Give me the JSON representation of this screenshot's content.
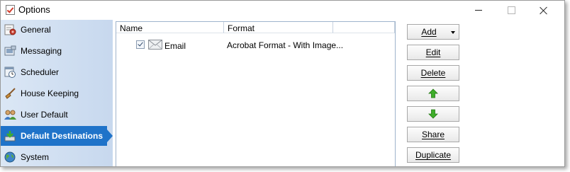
{
  "window": {
    "title": "Options"
  },
  "sidebar": {
    "items": [
      {
        "label": "General",
        "icon": "general-icon"
      },
      {
        "label": "Messaging",
        "icon": "messaging-icon"
      },
      {
        "label": "Scheduler",
        "icon": "scheduler-icon"
      },
      {
        "label": "House Keeping",
        "icon": "broom-icon"
      },
      {
        "label": "User Default",
        "icon": "users-icon"
      },
      {
        "label": "Default Destinations",
        "icon": "destination-icon",
        "selected": true
      },
      {
        "label": "System",
        "icon": "globe-icon"
      }
    ]
  },
  "list": {
    "columns": [
      "Name",
      "Format",
      ""
    ],
    "rows": [
      {
        "checked": true,
        "icon": "mail-icon",
        "name": "Email",
        "format": "Acrobat Format - With Image..."
      }
    ]
  },
  "buttons": {
    "add": "Add",
    "edit": "Edit",
    "delete": "Delete",
    "move_up_icon": "green-up-arrow-icon",
    "move_down_icon": "green-down-arrow-icon",
    "share": "Share",
    "duplicate": "Duplicate"
  },
  "colors": {
    "selected_nav": "#1f73c9",
    "sidebar_bg": "#c7d8ee",
    "arrow_green": "#3fae2a"
  }
}
